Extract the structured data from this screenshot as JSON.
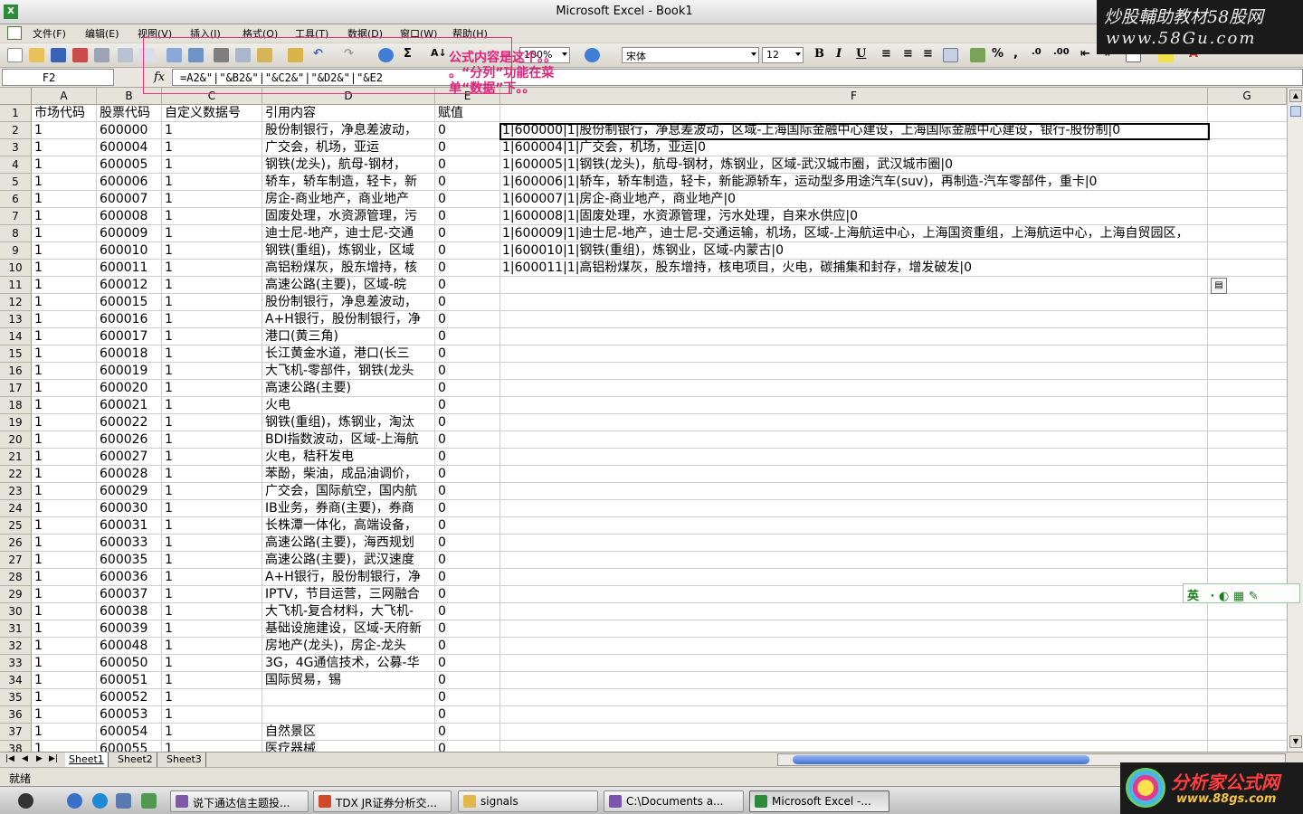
{
  "window": {
    "title": "Microsoft Excel - Book1"
  },
  "watermark_top": {
    "line1": "炒股輔助教材58股网",
    "line2": "www.58Gu.com"
  },
  "menu": [
    "文件(F)",
    "编辑(E)",
    "视图(V)",
    "插入(I)",
    "格式(O)",
    "工具(T)",
    "数据(D)",
    "窗口(W)",
    "帮助(H)"
  ],
  "toolbar": {
    "zoom": "100%",
    "font": "宋体",
    "size": "12",
    "bold": "B",
    "italic": "I",
    "underline": "U"
  },
  "annotation": {
    "line1": "公式内容是这个。。",
    "line2": "。“分列”功能在菜",
    "line3": "单“数据”下。。"
  },
  "formula_bar": {
    "cell_ref": "F2",
    "fx": "fx",
    "formula": "=A2&\"|\"&B2&\"|\"&C2&\"|\"&D2&\"|\"&E2"
  },
  "columns": [
    "A",
    "B",
    "C",
    "D",
    "E",
    "F",
    "G"
  ],
  "header_row": {
    "a": "市场代码",
    "b": "股票代码",
    "c": "自定义数据号",
    "d": "引用内容",
    "e": "赋值"
  },
  "rows": [
    {
      "n": "1"
    },
    {
      "n": "2",
      "a": "1",
      "b": "600000",
      "c": "1",
      "d": "股份制银行，净息差波动，",
      "e": "0",
      "f": "1|600000|1|股份制银行，净息差波动，区域-上海国际金融中心建设，上海国际金融中心建设，银行-股份制|0"
    },
    {
      "n": "3",
      "a": "1",
      "b": "600004",
      "c": "1",
      "d": "广交会，机场，亚运",
      "e": "0",
      "f": "1|600004|1|广交会，机场，亚运|0"
    },
    {
      "n": "4",
      "a": "1",
      "b": "600005",
      "c": "1",
      "d": "钢铁(龙头)，航母-钢材，",
      "e": "0",
      "f": "1|600005|1|钢铁(龙头)，航母-钢材，炼钢业，区域-武汉城市圈，武汉城市圈|0"
    },
    {
      "n": "5",
      "a": "1",
      "b": "600006",
      "c": "1",
      "d": "轿车，轿车制造，轻卡，新",
      "e": "0",
      "f": "1|600006|1|轿车，轿车制造，轻卡，新能源轿车，运动型多用途汽车(suv)，再制造-汽车零部件，重卡|0"
    },
    {
      "n": "6",
      "a": "1",
      "b": "600007",
      "c": "1",
      "d": "房企-商业地产，商业地产",
      "e": "0",
      "f": "1|600007|1|房企-商业地产，商业地产|0"
    },
    {
      "n": "7",
      "a": "1",
      "b": "600008",
      "c": "1",
      "d": "固废处理，水资源管理，污",
      "e": "0",
      "f": "1|600008|1|固废处理，水资源管理，污水处理，自来水供应|0"
    },
    {
      "n": "8",
      "a": "1",
      "b": "600009",
      "c": "1",
      "d": "迪士尼-地产，迪士尼-交通",
      "e": "0",
      "f": "1|600009|1|迪士尼-地产，迪士尼-交通运输，机场，区域-上海航运中心，上海国资重组，上海航运中心，上海自贸园区，"
    },
    {
      "n": "9",
      "a": "1",
      "b": "600010",
      "c": "1",
      "d": "钢铁(重组)，炼钢业，区域",
      "e": "0",
      "f": "1|600010|1|钢铁(重组)，炼钢业，区域-内蒙古|0"
    },
    {
      "n": "10",
      "a": "1",
      "b": "600011",
      "c": "1",
      "d": "高铝粉煤灰，股东增持，核",
      "e": "0",
      "f": "1|600011|1|高铝粉煤灰，股东增持，核电项目，火电，碳捕集和封存，增发破发|0"
    },
    {
      "n": "11",
      "a": "1",
      "b": "600012",
      "c": "1",
      "d": "高速公路(主要)，区域-皖",
      "e": "0"
    },
    {
      "n": "12",
      "a": "1",
      "b": "600015",
      "c": "1",
      "d": "股份制银行，净息差波动，",
      "e": "0"
    },
    {
      "n": "13",
      "a": "1",
      "b": "600016",
      "c": "1",
      "d": "A+H银行，股份制银行，净",
      "e": "0"
    },
    {
      "n": "14",
      "a": "1",
      "b": "600017",
      "c": "1",
      "d": "港口(黄三角)",
      "e": "0"
    },
    {
      "n": "15",
      "a": "1",
      "b": "600018",
      "c": "1",
      "d": "长江黄金水道，港口(长三",
      "e": "0"
    },
    {
      "n": "16",
      "a": "1",
      "b": "600019",
      "c": "1",
      "d": "大飞机-零部件，钢铁(龙头",
      "e": "0"
    },
    {
      "n": "17",
      "a": "1",
      "b": "600020",
      "c": "1",
      "d": "高速公路(主要)",
      "e": "0"
    },
    {
      "n": "18",
      "a": "1",
      "b": "600021",
      "c": "1",
      "d": "火电",
      "e": "0"
    },
    {
      "n": "19",
      "a": "1",
      "b": "600022",
      "c": "1",
      "d": "钢铁(重组)，炼钢业，淘汰",
      "e": "0"
    },
    {
      "n": "20",
      "a": "1",
      "b": "600026",
      "c": "1",
      "d": "BDI指数波动，区域-上海航",
      "e": "0"
    },
    {
      "n": "21",
      "a": "1",
      "b": "600027",
      "c": "1",
      "d": "火电，秸秆发电",
      "e": "0"
    },
    {
      "n": "22",
      "a": "1",
      "b": "600028",
      "c": "1",
      "d": "苯酚，柴油，成品油调价，",
      "e": "0"
    },
    {
      "n": "23",
      "a": "1",
      "b": "600029",
      "c": "1",
      "d": "广交会，国际航空，国内航",
      "e": "0"
    },
    {
      "n": "24",
      "a": "1",
      "b": "600030",
      "c": "1",
      "d": "IB业务，券商(主要)，券商",
      "e": "0"
    },
    {
      "n": "25",
      "a": "1",
      "b": "600031",
      "c": "1",
      "d": "长株潭一体化，高端设备，",
      "e": "0"
    },
    {
      "n": "26",
      "a": "1",
      "b": "600033",
      "c": "1",
      "d": "高速公路(主要)，海西规划",
      "e": "0"
    },
    {
      "n": "27",
      "a": "1",
      "b": "600035",
      "c": "1",
      "d": "高速公路(主要)，武汉速度",
      "e": "0"
    },
    {
      "n": "28",
      "a": "1",
      "b": "600036",
      "c": "1",
      "d": "A+H银行，股份制银行，净",
      "e": "0"
    },
    {
      "n": "29",
      "a": "1",
      "b": "600037",
      "c": "1",
      "d": "IPTV，节目运营，三网融合",
      "e": "0"
    },
    {
      "n": "30",
      "a": "1",
      "b": "600038",
      "c": "1",
      "d": "大飞机-复合材料，大飞机-",
      "e": "0"
    },
    {
      "n": "31",
      "a": "1",
      "b": "600039",
      "c": "1",
      "d": "基础设施建设，区域-天府新",
      "e": "0"
    },
    {
      "n": "32",
      "a": "1",
      "b": "600048",
      "c": "1",
      "d": "房地产(龙头)，房企-龙头",
      "e": "0"
    },
    {
      "n": "33",
      "a": "1",
      "b": "600050",
      "c": "1",
      "d": "3G，4G通信技术，公募-华",
      "e": "0"
    },
    {
      "n": "34",
      "a": "1",
      "b": "600051",
      "c": "1",
      "d": "国际贸易，锡",
      "e": "0"
    },
    {
      "n": "35",
      "a": "1",
      "b": "600052",
      "c": "1",
      "d": "",
      "e": "0"
    },
    {
      "n": "36",
      "a": "1",
      "b": "600053",
      "c": "1",
      "d": "",
      "e": "0"
    },
    {
      "n": "37",
      "a": "1",
      "b": "600054",
      "c": "1",
      "d": "自然景区",
      "e": "0"
    },
    {
      "n": "38",
      "a": "1",
      "b": "600055",
      "c": "1",
      "d": "医疗器械",
      "e": "0"
    }
  ],
  "sheets": [
    "Sheet1",
    "Sheet2",
    "Sheet3"
  ],
  "status": "就绪",
  "ime": "英",
  "taskbar": [
    {
      "label": "说下通达信主题投...",
      "color": "#7c5aa8"
    },
    {
      "label": "TDX JR证券分析交...",
      "color": "#d04a2a"
    },
    {
      "label": "signals",
      "color": "#e3b84a"
    },
    {
      "label": "C:\\Documents a...",
      "color": "#7a54b0"
    },
    {
      "label": "Microsoft Excel -...",
      "color": "#2e8b3a"
    }
  ],
  "watermark_bottom": {
    "line1": "分析家公式网",
    "line2": "www.88gs.com"
  }
}
